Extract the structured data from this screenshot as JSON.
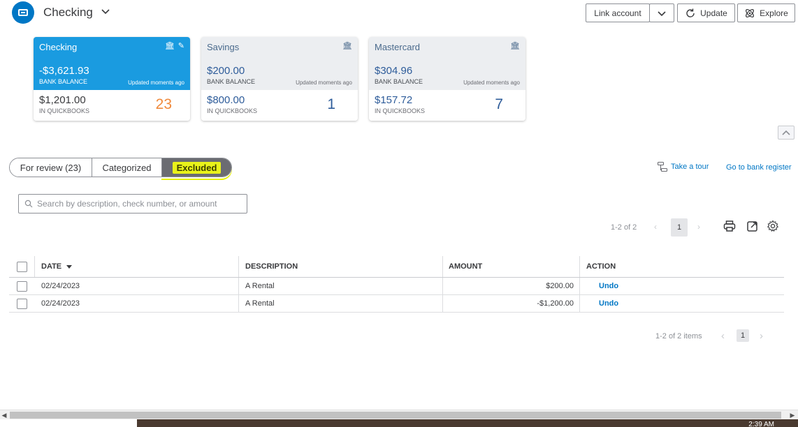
{
  "header": {
    "account_title": "Checking",
    "link_account_label": "Link account",
    "update_label": "Update",
    "explore_label": "Explore"
  },
  "accounts": [
    {
      "name": "Checking",
      "bank_balance": "-$3,621.93",
      "bank_balance_label": "BANK BALANCE",
      "updated": "Updated moments ago",
      "qb_balance": "$1,201.00",
      "qb_label": "IN QUICKBOOKS",
      "count": "23",
      "active": true
    },
    {
      "name": "Savings",
      "bank_balance": "$200.00",
      "bank_balance_label": "BANK BALANCE",
      "updated": "Updated moments ago",
      "qb_balance": "$800.00",
      "qb_label": "IN QUICKBOOKS",
      "count": "1",
      "active": false
    },
    {
      "name": "Mastercard",
      "bank_balance": "$304.96",
      "bank_balance_label": "BANK BALANCE",
      "updated": "Updated moments ago",
      "qb_balance": "$157.72",
      "qb_label": "IN QUICKBOOKS",
      "count": "7",
      "active": false
    }
  ],
  "tabs": [
    {
      "label": "For review (23)"
    },
    {
      "label": "Categorized"
    },
    {
      "label": "Excluded",
      "active": true
    }
  ],
  "links": {
    "tour": "Take a tour",
    "register": "Go to bank register"
  },
  "search": {
    "placeholder": "Search by description, check number, or amount"
  },
  "pager_top": {
    "text": "1-2 of 2",
    "page": "1"
  },
  "table": {
    "headers": {
      "date": "DATE",
      "description": "DESCRIPTION",
      "amount": "AMOUNT",
      "action": "ACTION"
    },
    "rows": [
      {
        "date": "02/24/2023",
        "description": "A Rental",
        "amount": "$200.00",
        "action": "Undo"
      },
      {
        "date": "02/24/2023",
        "description": "A Rental",
        "amount": "-$1,200.00",
        "action": "Undo"
      }
    ]
  },
  "pager_bottom": {
    "text": "1-2 of 2 items",
    "page": "1"
  },
  "taskbar": {
    "clock": "2:39 AM"
  },
  "colors": {
    "brand_blue": "#0077c5",
    "active_card": "#1a9be0",
    "highlight": "#e9f21a",
    "count_orange": "#f08a3c"
  }
}
